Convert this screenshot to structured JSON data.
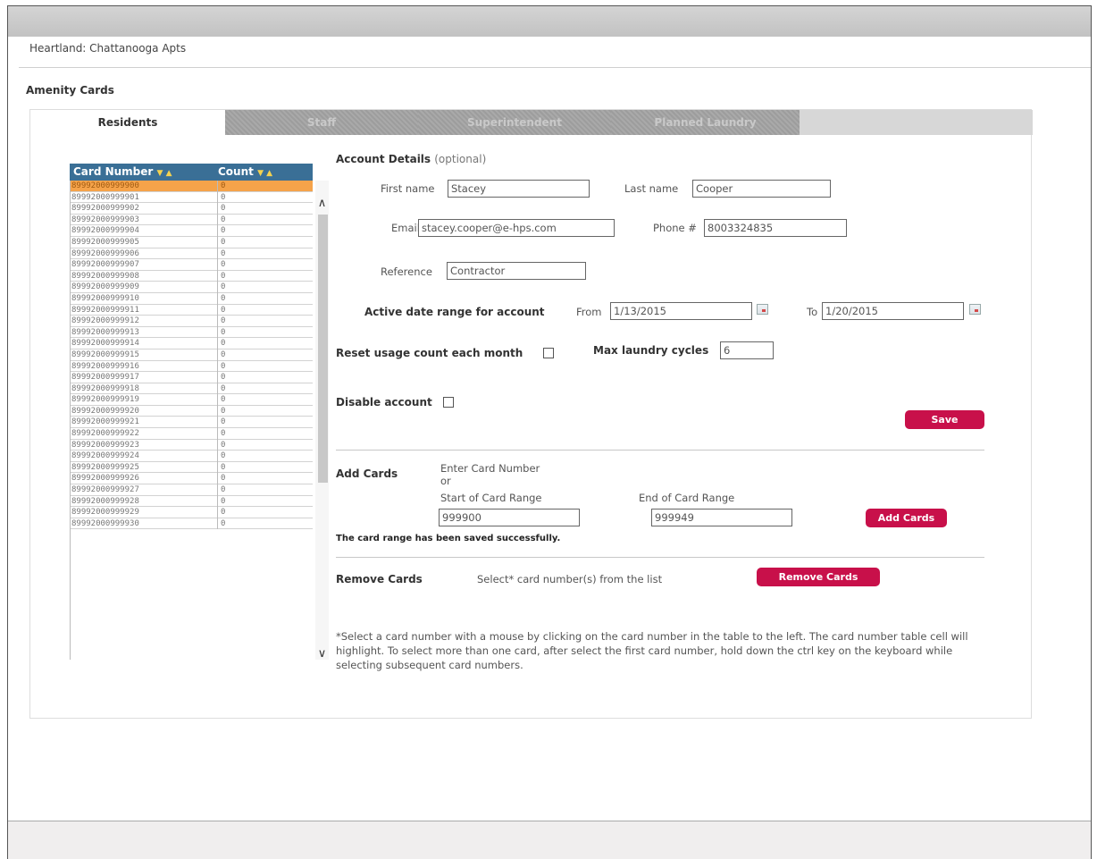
{
  "breadcrumb": "Heartland: Chattanooga Apts",
  "page_title": "Amenity Cards",
  "tabs": [
    {
      "label": "Residents",
      "active": true
    },
    {
      "label": "Staff",
      "active": false
    },
    {
      "label": "Superintendent",
      "active": false
    },
    {
      "label": "Planned Laundry",
      "active": false
    }
  ],
  "grid": {
    "col_card": "Card Number",
    "col_count": "Count",
    "sort_arrows": "▼ ▲",
    "rows": [
      {
        "card": "89992000999900",
        "count": "0",
        "selected": true
      },
      {
        "card": "89992000999901",
        "count": "0"
      },
      {
        "card": "89992000999902",
        "count": "0"
      },
      {
        "card": "89992000999903",
        "count": "0"
      },
      {
        "card": "89992000999904",
        "count": "0"
      },
      {
        "card": "89992000999905",
        "count": "0"
      },
      {
        "card": "89992000999906",
        "count": "0"
      },
      {
        "card": "89992000999907",
        "count": "0"
      },
      {
        "card": "89992000999908",
        "count": "0"
      },
      {
        "card": "89992000999909",
        "count": "0"
      },
      {
        "card": "89992000999910",
        "count": "0"
      },
      {
        "card": "89992000999911",
        "count": "0"
      },
      {
        "card": "89992000999912",
        "count": "0"
      },
      {
        "card": "89992000999913",
        "count": "0"
      },
      {
        "card": "89992000999914",
        "count": "0"
      },
      {
        "card": "89992000999915",
        "count": "0"
      },
      {
        "card": "89992000999916",
        "count": "0"
      },
      {
        "card": "89992000999917",
        "count": "0"
      },
      {
        "card": "89992000999918",
        "count": "0"
      },
      {
        "card": "89992000999919",
        "count": "0"
      },
      {
        "card": "89992000999920",
        "count": "0"
      },
      {
        "card": "89992000999921",
        "count": "0"
      },
      {
        "card": "89992000999922",
        "count": "0"
      },
      {
        "card": "89992000999923",
        "count": "0"
      },
      {
        "card": "89992000999924",
        "count": "0"
      },
      {
        "card": "89992000999925",
        "count": "0"
      },
      {
        "card": "89992000999926",
        "count": "0"
      },
      {
        "card": "89992000999927",
        "count": "0"
      },
      {
        "card": "89992000999928",
        "count": "0"
      },
      {
        "card": "89992000999929",
        "count": "0"
      },
      {
        "card": "89992000999930",
        "count": "0"
      }
    ]
  },
  "account": {
    "title": "Account Details",
    "optional": "(optional)",
    "first_name_label": "First name",
    "first_name": "Stacey",
    "last_name_label": "Last name",
    "last_name": "Cooper",
    "email_label": "Email",
    "email": "stacey.cooper@e-hps.com",
    "phone_label": "Phone #",
    "phone": "8003324835",
    "reference_label": "Reference",
    "reference": "Contractor",
    "date_range_label": "Active date range for account",
    "from_label": "From",
    "from_date": "1/13/2015",
    "to_label": "To",
    "to_date": "1/20/2015",
    "reset_label": "Reset usage count each month",
    "max_cycles_label": "Max laundry cycles",
    "max_cycles": "6",
    "disable_label": "Disable account",
    "save_label": "Save"
  },
  "add_cards": {
    "title": "Add Cards",
    "enter_label": "Enter Card Number",
    "or_label": "or",
    "start_label": "Start of Card Range",
    "start_value": "999900",
    "end_label": "End of Card Range",
    "end_value": "999949",
    "button_label": "Add Cards",
    "status": "The card range has been saved successfully."
  },
  "remove_cards": {
    "title": "Remove Cards",
    "instruction": "Select* card number(s) from the list",
    "button_label": "Remove Cards"
  },
  "footnote": "*Select a card number with a mouse by clicking on the card number in the table to the left. The card number table cell will highlight. To select more than one card, after select the first card number, hold down the ctrl key on the keyboard while selecting subsequent card numbers."
}
